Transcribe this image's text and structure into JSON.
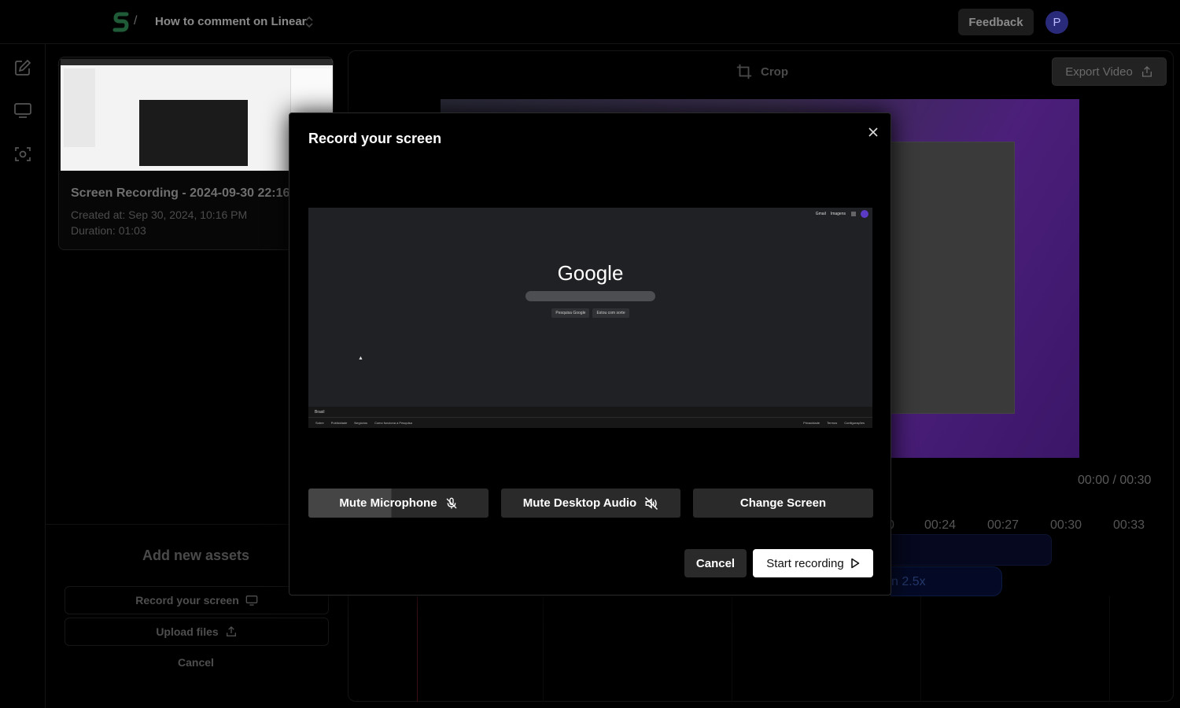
{
  "header": {
    "separator": "/",
    "project_title": "How to comment on Linear",
    "feedback_label": "Feedback",
    "avatar_initial": "P"
  },
  "assets": {
    "card": {
      "name": "Screen Recording - 2024-09-30 22:16",
      "created": "Created at: Sep 30, 2024, 10:16 PM",
      "duration": "Duration: 01:03"
    },
    "add_title": "Add new assets",
    "record_label": "Record your screen",
    "upload_label": "Upload files",
    "cancel_label": "Cancel"
  },
  "editor": {
    "crop_label": "Crop",
    "export_label": "Export Video",
    "time_readout": "00:00 / 00:30",
    "ticks": [
      "0",
      "00:24",
      "00:27",
      "00:30",
      "00:33"
    ],
    "track_label": "n 2.5x"
  },
  "modal": {
    "title": "Record your screen",
    "screen_preview": {
      "logo": "Google",
      "top_links": [
        "Gmail",
        "Imagens"
      ],
      "buttons": [
        "Pesquisa Google",
        "Estou com sorte"
      ],
      "country": "Brasil",
      "footer_left": [
        "Sobre",
        "Publicidade",
        "Negócios",
        "Como funciona a Pesquisa"
      ],
      "footer_right": [
        "Privacidade",
        "Termos",
        "Configurações"
      ]
    },
    "mute_mic_label": "Mute Microphone",
    "mute_desktop_label": "Mute Desktop Audio",
    "change_screen_label": "Change Screen",
    "cancel_label": "Cancel",
    "start_label": "Start recording"
  },
  "colors": {
    "background": "#000000",
    "accent_white": "#ffffff",
    "button_dark": "#2a2a2a",
    "avatar": "#2a2a7a"
  }
}
